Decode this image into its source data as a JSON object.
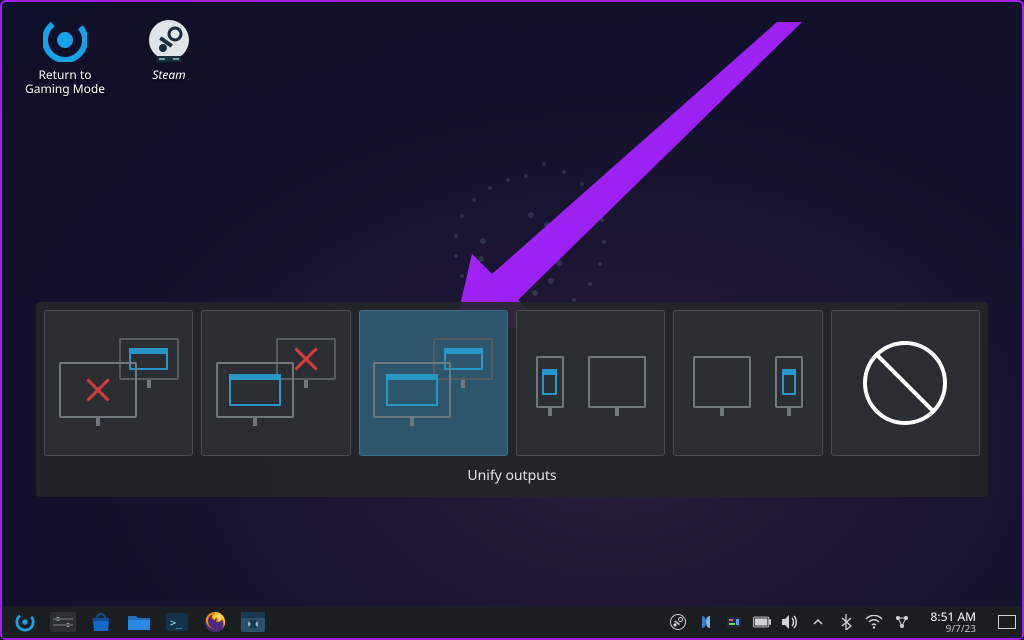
{
  "desktop": {
    "icons": [
      {
        "name": "return-to-gaming-mode",
        "label": "Return to\nGaming Mode"
      },
      {
        "name": "steam",
        "label": "Steam"
      }
    ]
  },
  "osd": {
    "caption": "Unify outputs",
    "options": [
      {
        "name": "external-only",
        "selected": false
      },
      {
        "name": "internal-only",
        "selected": false
      },
      {
        "name": "unify-outputs",
        "selected": true
      },
      {
        "name": "extend-left",
        "selected": false
      },
      {
        "name": "extend-right",
        "selected": false
      },
      {
        "name": "do-nothing",
        "selected": false
      }
    ]
  },
  "taskbar": {
    "launchers": [
      {
        "name": "steamdeck-menu",
        "icon": "steamdeck-logo-icon"
      },
      {
        "name": "settings",
        "icon": "settings-sliders-icon"
      },
      {
        "name": "discover-store",
        "icon": "shopping-bag-icon"
      },
      {
        "name": "file-manager",
        "icon": "folder-icon"
      },
      {
        "name": "konsole",
        "icon": "terminal-icon"
      },
      {
        "name": "firefox",
        "icon": "firefox-icon"
      },
      {
        "name": "media-app",
        "icon": "clapboard-icon"
      }
    ],
    "tray": {
      "icons": [
        "steam-tray-icon",
        "qb-tray-icon",
        "disk-activity-icon",
        "battery-icon",
        "volume-icon",
        "chevron-up-icon",
        "bluetooth-icon",
        "wifi-icon",
        "network-icon"
      ],
      "clock": {
        "time": "8:51 AM",
        "date": "9/7/23"
      }
    }
  },
  "colors": {
    "accent": "#2996c8",
    "danger": "#d63c3c",
    "annotation": "#a020f0"
  }
}
